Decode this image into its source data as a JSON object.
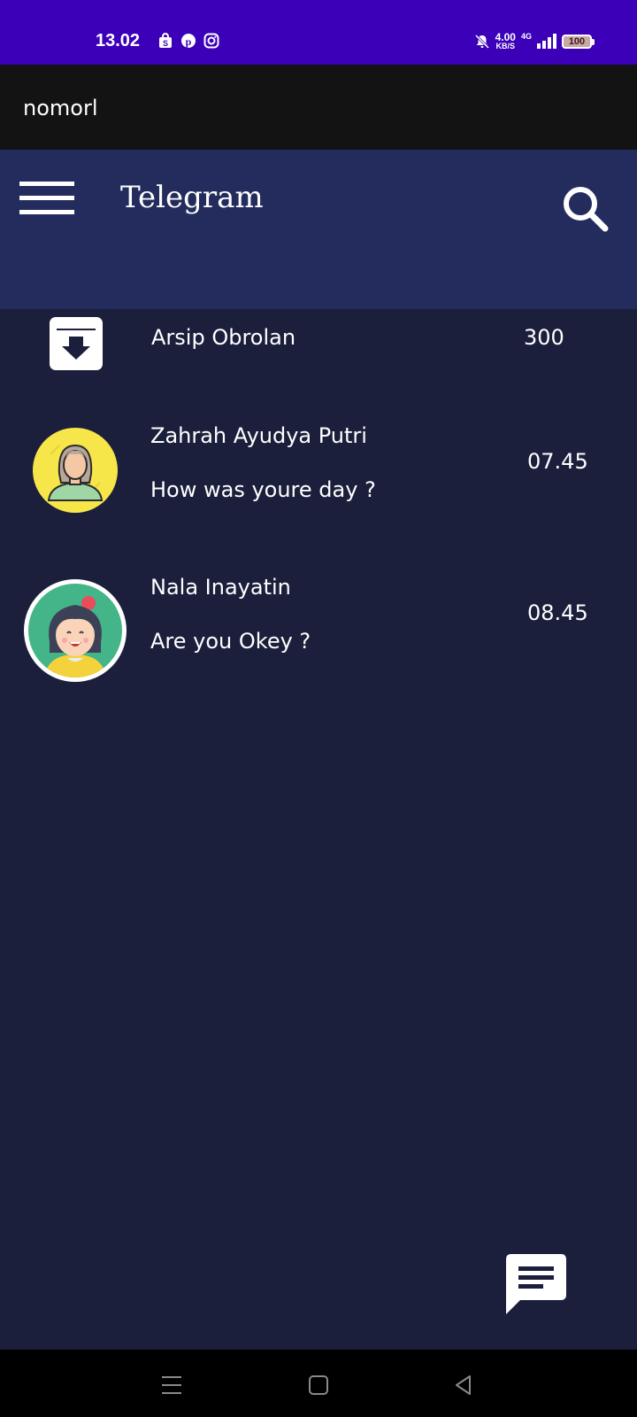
{
  "status_bar": {
    "time": "13.02",
    "net_speed_value": "4.00",
    "net_speed_unit": "KB/S",
    "network_type": "4G",
    "battery_level": "100",
    "icons": [
      "shop-icon",
      "pinterest-icon",
      "instagram-icon",
      "mute-icon",
      "signal-icon",
      "battery-icon"
    ]
  },
  "app": {
    "title": "nomorl"
  },
  "toolbar": {
    "title": "Telegram"
  },
  "archive": {
    "label": "Arsip Obrolan",
    "count": "300"
  },
  "chats": [
    {
      "name": "Zahrah Ayudya Putri",
      "message": "How was youre day ?",
      "time": "07.45"
    },
    {
      "name": "Nala Inayatin",
      "message": "Are you Okey ?",
      "time": "08.45"
    }
  ],
  "colors": {
    "status_bar": "#3b00b8",
    "title_bar": "#131313",
    "toolbar": "#232c5c",
    "background": "#1b1f3c"
  }
}
